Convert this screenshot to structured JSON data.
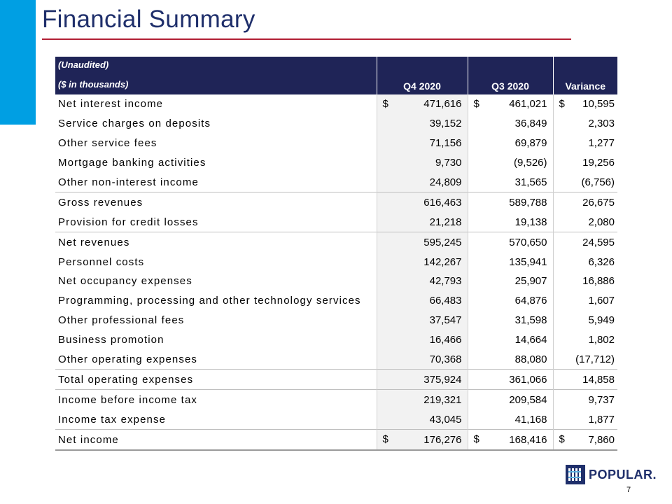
{
  "title": "Financial Summary",
  "header": {
    "line1": "(Unaudited)",
    "line2": "($ in thousands)",
    "columns": [
      "Q4 2020",
      "Q3 2020",
      "Variance"
    ]
  },
  "rows": [
    {
      "label": "Net interest income",
      "q4": "471,616",
      "q3": "461,021",
      "var": "10,595",
      "dollar": "$"
    },
    {
      "label": "Service charges on deposits",
      "q4": "39,152",
      "q3": "36,849",
      "var": "2,303"
    },
    {
      "label": "Other service fees",
      "q4": "71,156",
      "q3": "69,879",
      "var": "1,277"
    },
    {
      "label": "Mortgage banking activities",
      "q4": "9,730",
      "q3": "(9,526)",
      "var": "19,256"
    },
    {
      "label": "Other non-interest income",
      "q4": "24,809",
      "q3": "31,565",
      "var": "(6,756)"
    },
    {
      "label": "Gross revenues",
      "q4": "616,463",
      "q3": "589,788",
      "var": "26,675"
    },
    {
      "label": "Provision for credit losses",
      "q4": "21,218",
      "q3": "19,138",
      "var": "2,080"
    },
    {
      "label": "Net revenues",
      "q4": "595,245",
      "q3": "570,650",
      "var": "24,595"
    },
    {
      "label": "Personnel costs",
      "q4": "142,267",
      "q3": "135,941",
      "var": "6,326"
    },
    {
      "label": "Net occupancy expenses",
      "q4": "42,793",
      "q3": "25,907",
      "var": "16,886"
    },
    {
      "label": "Programming, processing and other technology services",
      "q4": "66,483",
      "q3": "64,876",
      "var": "1,607"
    },
    {
      "label": "Other professional fees",
      "q4": "37,547",
      "q3": "31,598",
      "var": "5,949"
    },
    {
      "label": "Business promotion",
      "q4": "16,466",
      "q3": "14,664",
      "var": "1,802"
    },
    {
      "label": "Other operating expenses",
      "q4": "70,368",
      "q3": "88,080",
      "var": "(17,712)"
    },
    {
      "label": "Total operating expenses",
      "q4": "375,924",
      "q3": "361,066",
      "var": "14,858"
    },
    {
      "label": "Income before income tax",
      "q4": "219,321",
      "q3": "209,584",
      "var": "9,737"
    },
    {
      "label": "Income tax expense",
      "q4": "43,045",
      "q3": "41,168",
      "var": "1,877"
    },
    {
      "label": "Net income",
      "q4": "176,276",
      "q3": "168,416",
      "var": "7,860",
      "dollar": "$"
    }
  ],
  "logo": {
    "text": "POPULAR."
  },
  "page_number": "7",
  "colors": {
    "header_bg": "#1f2457",
    "title": "#1f2f6b",
    "rule": "#b21f35",
    "side_bar": "#009fe3"
  }
}
